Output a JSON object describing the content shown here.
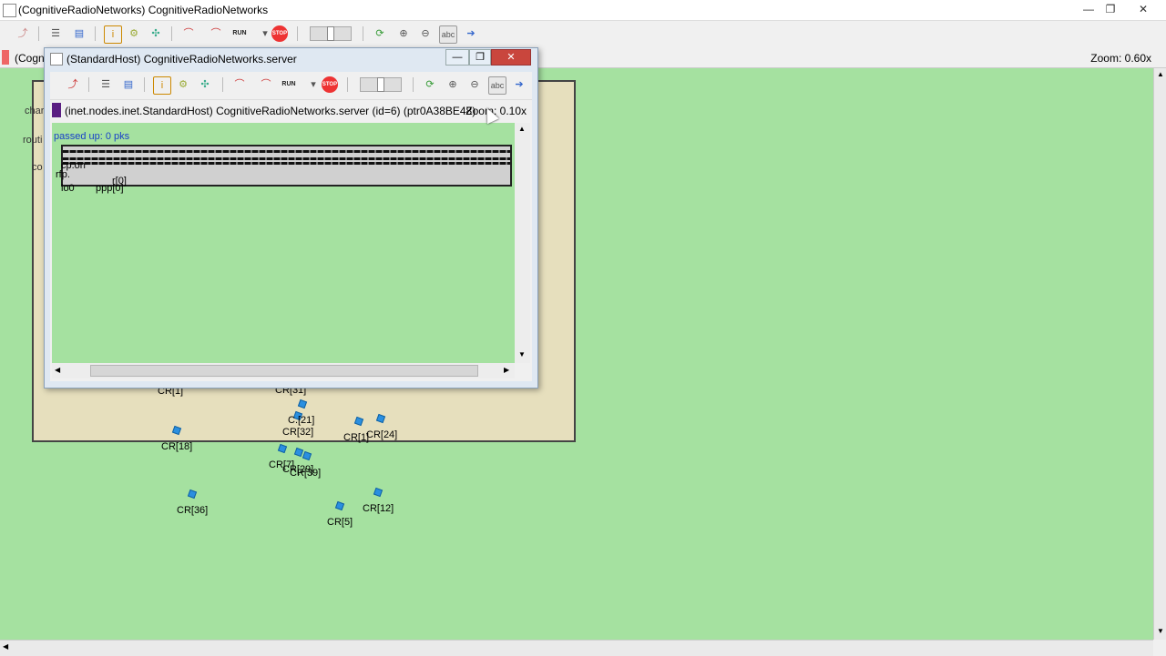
{
  "main_window": {
    "title": "(CognitiveRadioNetworks) CognitiveRadioNetworks",
    "info_label": "(Cogn",
    "zoom_label": "Zoom: 0.60x",
    "toolbar": {
      "run_label": "RUN",
      "stop_label": "STOP",
      "abc_label": "abc"
    },
    "window_buttons": {
      "minimize": "—",
      "restore": "❐",
      "close": "✕"
    }
  },
  "compound_side_labels": [
    "char",
    "routi",
    "co"
  ],
  "cr_nodes": [
    {
      "label": "CR[1]"
    },
    {
      "label": "CR[31]"
    },
    {
      "label": "C.[21]"
    },
    {
      "label": "CR[32]"
    },
    {
      "label": "CR[18]"
    },
    {
      "label": "CR[1]"
    },
    {
      "label": "CR[24]"
    },
    {
      "label": "CR[7]"
    },
    {
      "label": "CR[29]"
    },
    {
      "label": "CR[39]"
    },
    {
      "label": "CR[36]"
    },
    {
      "label": "CR[12]"
    },
    {
      "label": "CR[5]"
    }
  ],
  "inner_window": {
    "title": "(StandardHost) CognitiveRadioNetworks.server",
    "info_label": "(inet.nodes.inet.StandardHost) CognitiveRadioNetworks.server  (id=6)  (ptr0A38BE48)",
    "zoom_label": "Zoom: 0.10x",
    "toolbar": {
      "run_label": "RUN",
      "stop_label": "STOP",
      "abc_label": "abc"
    },
    "window_buttons": {
      "minimize": "—",
      "restore": "❐",
      "close": "✕"
    },
    "canvas": {
      "passed_up": "passed up: 0 pks",
      "submodule_lo": "lo0",
      "submodule_ppp": "ppp[0]",
      "overlap_text_1": "cp.on",
      "overlap_text_2": "rfp.",
      "overlap_text_3": "r[0]"
    }
  }
}
